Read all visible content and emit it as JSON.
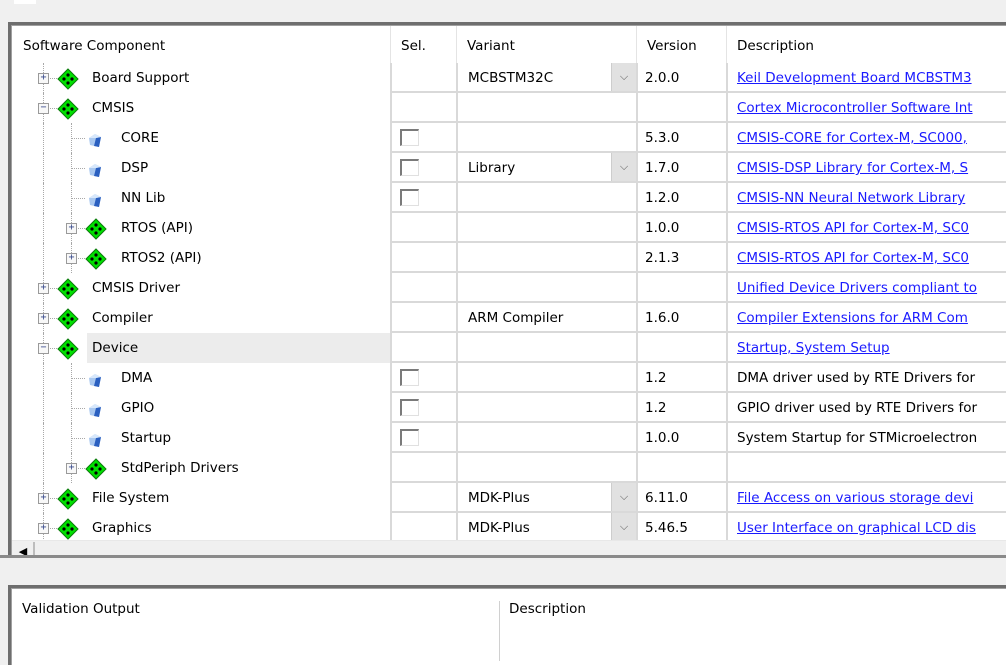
{
  "columns": {
    "component": "Software Component",
    "sel": "Sel.",
    "variant": "Variant",
    "version": "Version",
    "description": "Description"
  },
  "rows": [
    {
      "name": "Board Support",
      "level": 0,
      "icon": "green-diamond-icon",
      "expander": "+",
      "checkbox": false,
      "variant": "MCBSTM32C",
      "dropdown": true,
      "version": "2.0.0",
      "description": "Keil Development Board MCBSTM3",
      "desc_link": true
    },
    {
      "name": "CMSIS",
      "level": 0,
      "icon": "green-diamond-icon",
      "expander": "-",
      "checkbox": false,
      "variant": "",
      "dropdown": false,
      "version": "",
      "description": "Cortex Microcontroller Software Int",
      "desc_link": true
    },
    {
      "name": "CORE",
      "level": 1,
      "icon": "blue-gem-icon",
      "expander": "",
      "checkbox": true,
      "variant": "",
      "dropdown": false,
      "version": "5.3.0",
      "description": "CMSIS-CORE for Cortex-M, SC000,",
      "desc_link": true
    },
    {
      "name": "DSP",
      "level": 1,
      "icon": "blue-gem-icon",
      "expander": "",
      "checkbox": true,
      "variant": "Library",
      "dropdown": true,
      "version": "1.7.0",
      "description": "CMSIS-DSP Library for Cortex-M, S",
      "desc_link": true
    },
    {
      "name": "NN Lib",
      "level": 1,
      "icon": "blue-gem-icon",
      "expander": "",
      "checkbox": true,
      "variant": "",
      "dropdown": false,
      "version": "1.2.0",
      "description": "CMSIS-NN Neural Network Library",
      "desc_link": true
    },
    {
      "name": "RTOS (API)",
      "level": 1,
      "icon": "green-diamond-icon",
      "expander": "+",
      "checkbox": false,
      "variant": "",
      "dropdown": false,
      "version": "1.0.0",
      "description": "CMSIS-RTOS API for Cortex-M, SC0",
      "desc_link": true
    },
    {
      "name": "RTOS2 (API)",
      "level": 1,
      "icon": "green-diamond-icon",
      "expander": "+",
      "checkbox": false,
      "variant": "",
      "dropdown": false,
      "version": "2.1.3",
      "description": "CMSIS-RTOS API for Cortex-M, SC0",
      "desc_link": true
    },
    {
      "name": "CMSIS Driver",
      "level": 0,
      "icon": "green-diamond-icon",
      "expander": "+",
      "checkbox": false,
      "variant": "",
      "dropdown": false,
      "version": "",
      "description": "Unified Device Drivers compliant to",
      "desc_link": true
    },
    {
      "name": "Compiler",
      "level": 0,
      "icon": "green-diamond-icon",
      "expander": "+",
      "checkbox": false,
      "variant": "ARM Compiler",
      "dropdown": false,
      "version": "1.6.0",
      "description": "Compiler Extensions for ARM Com",
      "desc_link": true
    },
    {
      "name": "Device",
      "level": 0,
      "icon": "green-diamond-icon",
      "expander": "-",
      "checkbox": false,
      "variant": "",
      "dropdown": false,
      "version": "",
      "description": "Startup, System Setup",
      "desc_link": true,
      "highlighted": true
    },
    {
      "name": "DMA",
      "level": 1,
      "icon": "blue-gem-icon",
      "expander": "",
      "checkbox": true,
      "variant": "",
      "dropdown": false,
      "version": "1.2",
      "description": "DMA driver used by RTE Drivers for",
      "desc_link": false
    },
    {
      "name": "GPIO",
      "level": 1,
      "icon": "blue-gem-icon",
      "expander": "",
      "checkbox": true,
      "variant": "",
      "dropdown": false,
      "version": "1.2",
      "description": "GPIO driver used by RTE Drivers for",
      "desc_link": false
    },
    {
      "name": "Startup",
      "level": 1,
      "icon": "blue-gem-icon",
      "expander": "",
      "checkbox": true,
      "variant": "",
      "dropdown": false,
      "version": "1.0.0",
      "description": "System Startup for STMicroelectron",
      "desc_link": false
    },
    {
      "name": "StdPeriph Drivers",
      "level": 1,
      "icon": "green-diamond-icon",
      "expander": "+",
      "checkbox": false,
      "variant": "",
      "dropdown": false,
      "version": "",
      "description": "",
      "desc_link": false
    },
    {
      "name": "File System",
      "level": 0,
      "icon": "green-diamond-icon",
      "expander": "+",
      "checkbox": false,
      "variant": "MDK-Plus",
      "dropdown": true,
      "version": "6.11.0",
      "description": "File Access on various storage devi",
      "desc_link": true
    },
    {
      "name": "Graphics",
      "level": 0,
      "icon": "green-diamond-icon",
      "expander": "+",
      "checkbox": false,
      "variant": "MDK-Plus",
      "dropdown": true,
      "version": "5.46.5",
      "description": "User Interface on graphical LCD dis",
      "desc_link": true,
      "partial": true
    }
  ],
  "scrollbar": {
    "left_arrow": "◀"
  },
  "lower": {
    "validation_output": "Validation Output",
    "description": "Description"
  },
  "colors": {
    "link": "#1a1aff",
    "green_icon": "#00e000",
    "blue_icon": "#3a78d8",
    "highlight": "#ececec"
  }
}
